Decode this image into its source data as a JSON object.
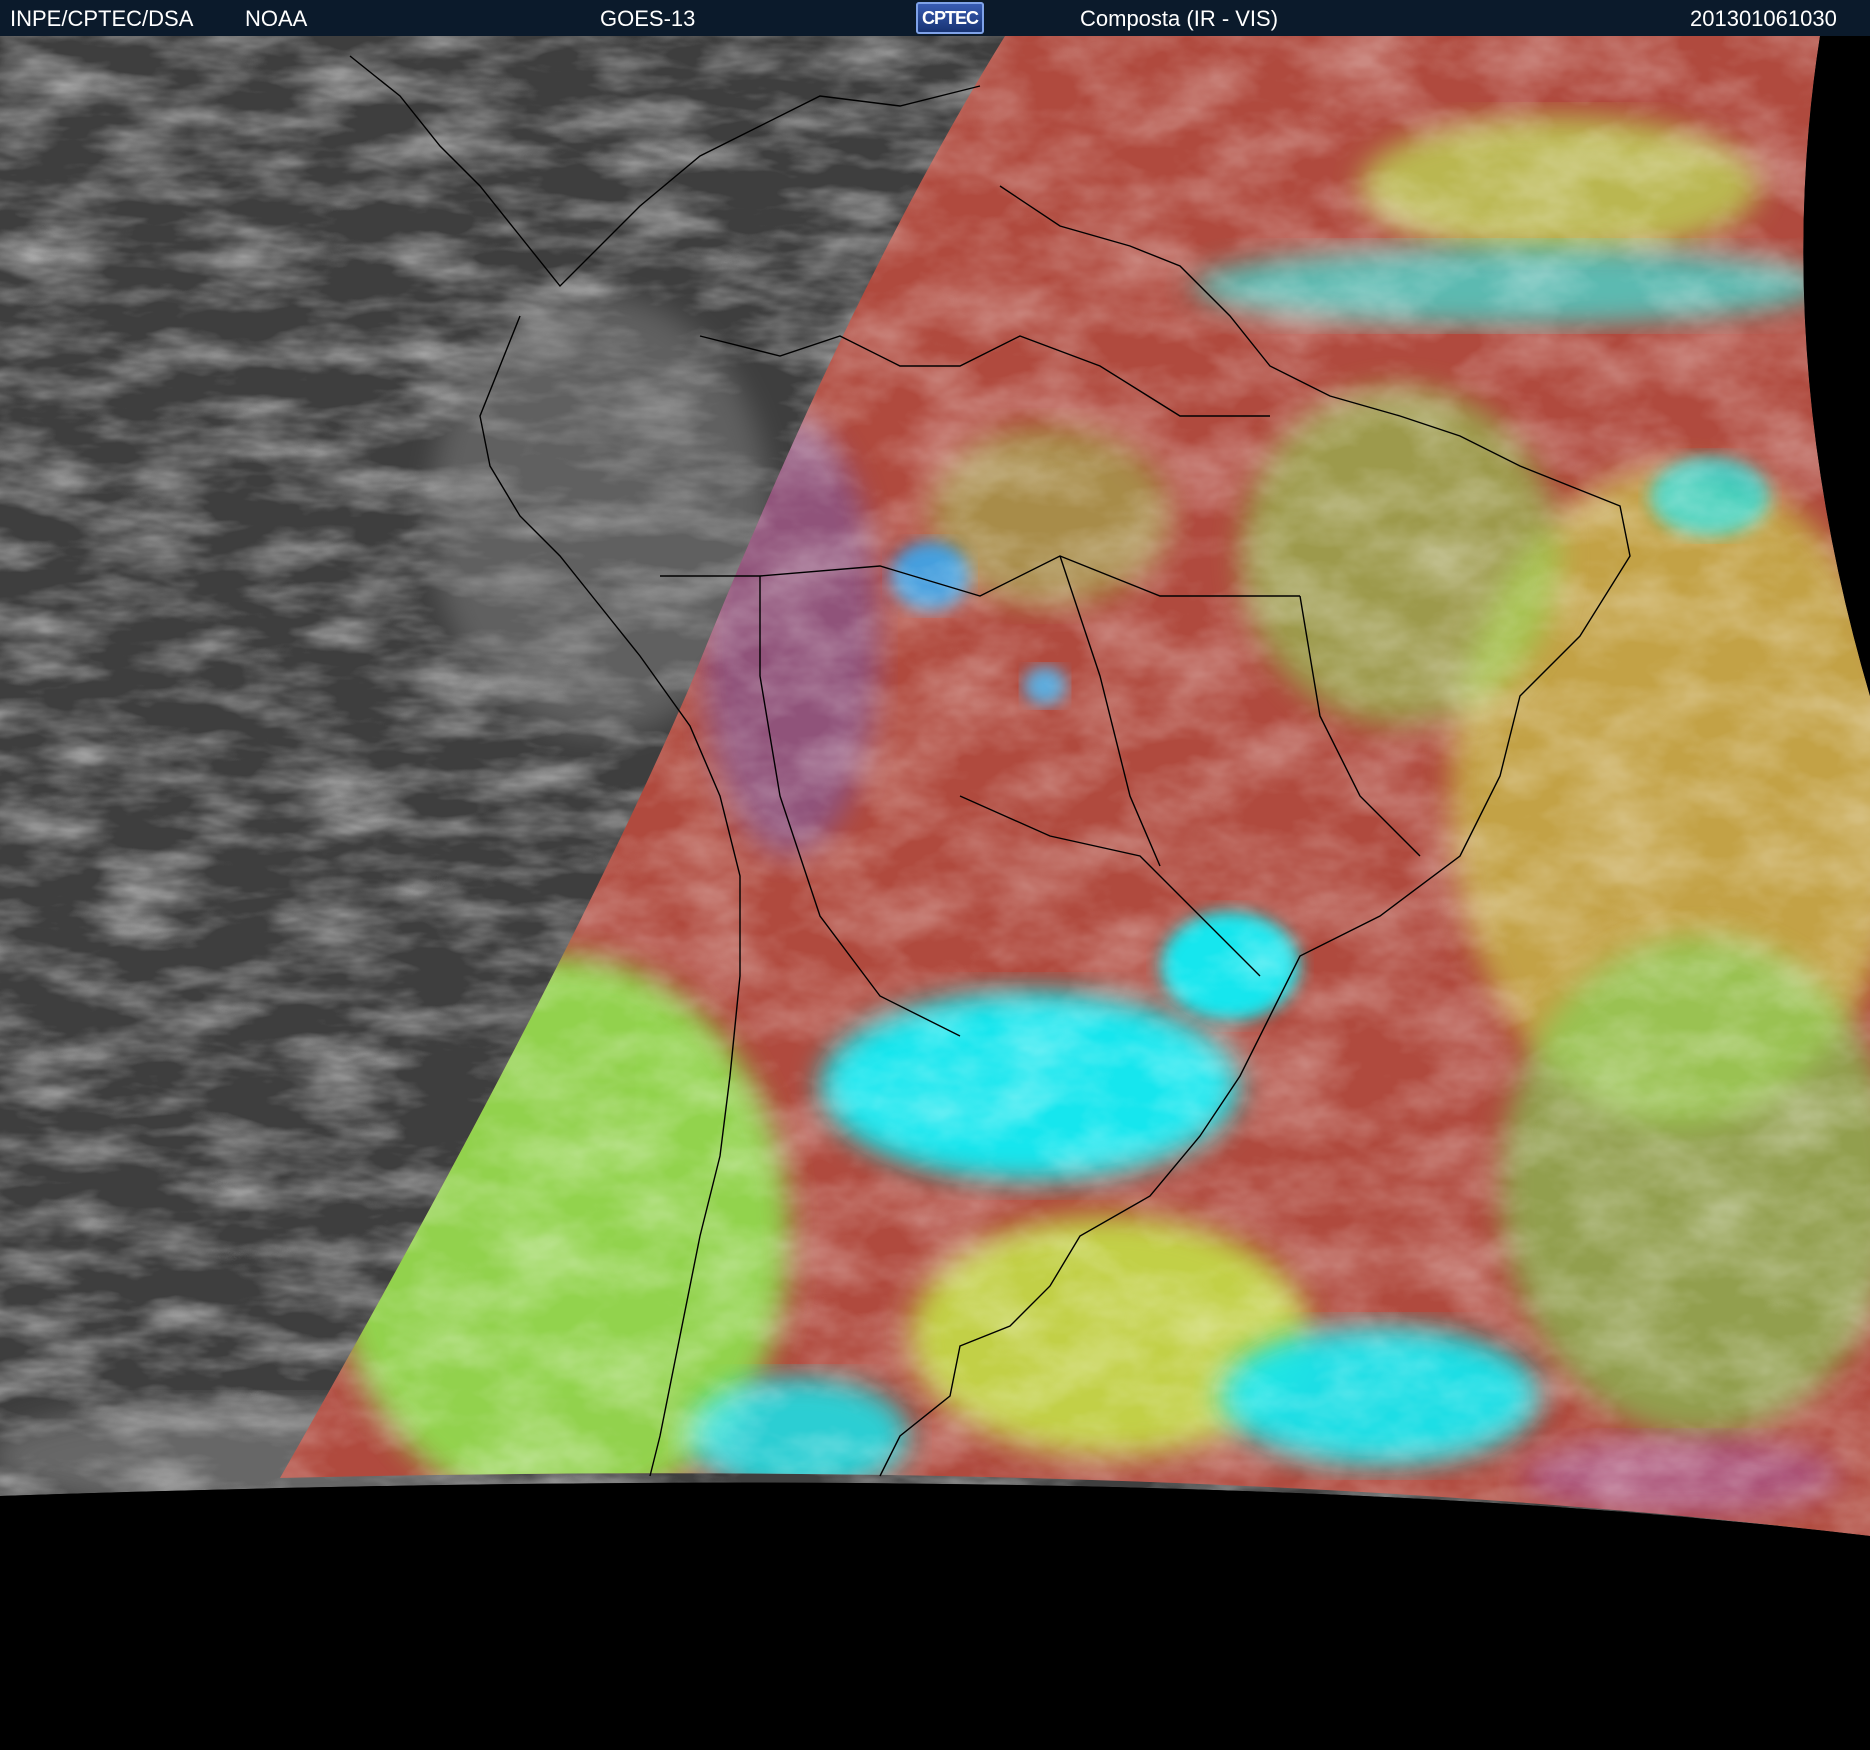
{
  "header": {
    "agency": "INPE/CPTEC/DSA",
    "partner": "NOAA",
    "satellite": "GOES-13",
    "logo_text": "CPTEC",
    "product": "Composta (IR - VIS)",
    "timestamp": "201301061030"
  },
  "colors": {
    "header_bg": "#0b1a2b",
    "gray_region": "#404040",
    "clear_sky": "#b04a3e",
    "low_cloud": "#8fe24f",
    "high_cloud": "#17e6ee",
    "off_disk": "#000000",
    "borders": "#000000"
  }
}
